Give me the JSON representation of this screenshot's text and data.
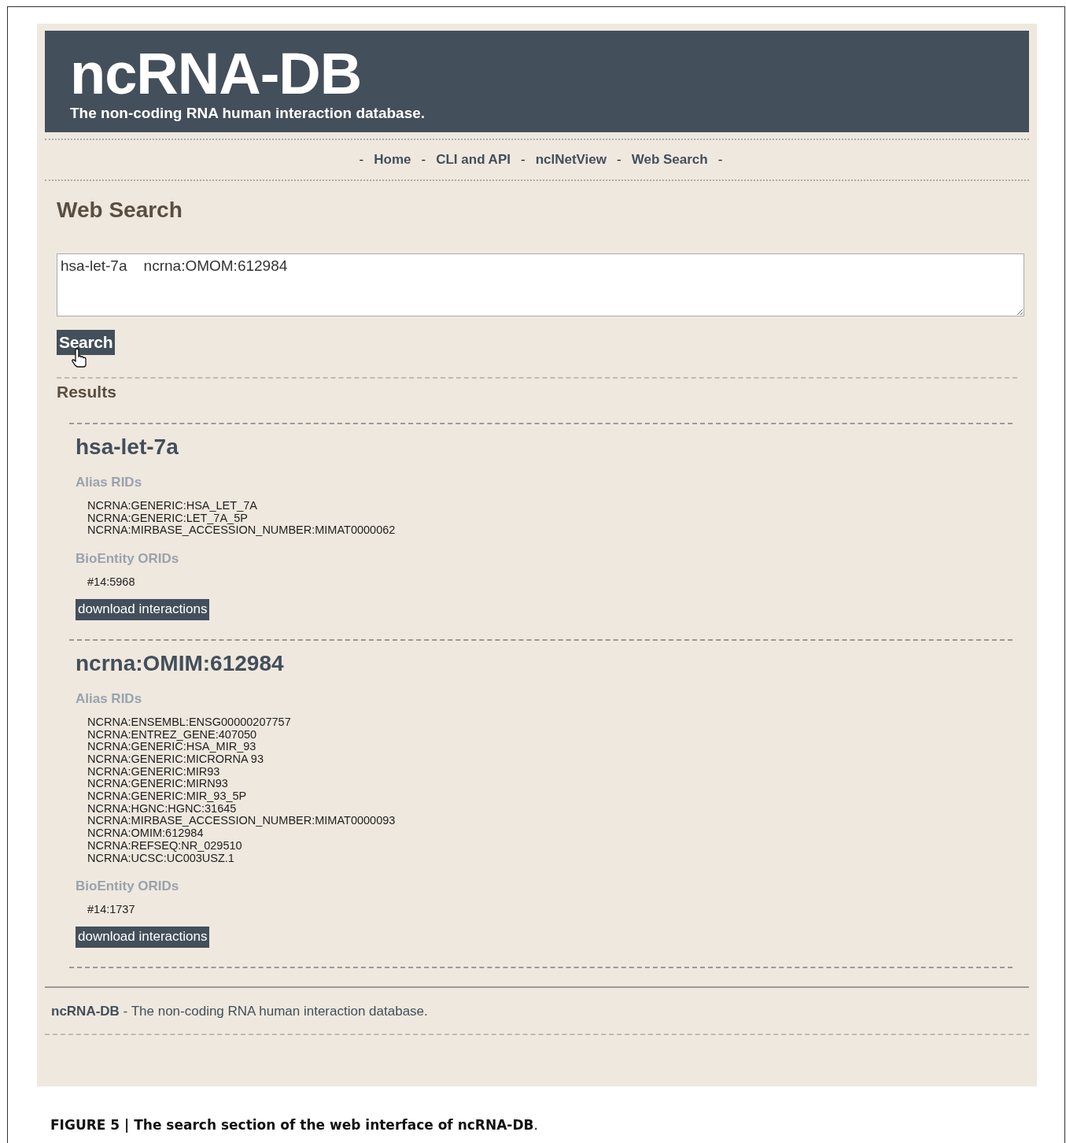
{
  "header": {
    "title": "ncRNA-DB",
    "subtitle": "The non-coding RNA human interaction database."
  },
  "nav": [
    {
      "kind": "separator",
      "text": "-"
    },
    {
      "kind": "link",
      "text": "Home"
    },
    {
      "kind": "separator",
      "text": "-"
    },
    {
      "kind": "link",
      "text": "CLI and API"
    },
    {
      "kind": "separator",
      "text": "-"
    },
    {
      "kind": "link",
      "text": "nclNetView"
    },
    {
      "kind": "separator",
      "text": "-"
    },
    {
      "kind": "link",
      "text": "Web Search"
    },
    {
      "kind": "separator",
      "text": "-"
    }
  ],
  "page_title": "Web Search",
  "search": {
    "value": "hsa-let-7a    ncrna:OMOM:612984",
    "button": "Search"
  },
  "results_heading": "Results",
  "results": [
    {
      "title": "hsa-let-7a",
      "alias_label": "Alias RIDs",
      "aliases": [
        "NCRNA:GENERIC:HSA_LET_7A",
        "NCRNA:GENERIC:LET_7A_5P",
        "NCRNA:MIRBASE_ACCESSION_NUMBER:MIMAT0000062"
      ],
      "orid_label": "BioEntity ORIDs",
      "orids": [
        "#14:5968"
      ],
      "button": "download interactions"
    },
    {
      "title": "ncrna:OMIM:612984",
      "alias_label": "Alias RIDs",
      "aliases": [
        "NCRNA:ENSEMBL:ENSG00000207757",
        "NCRNA:ENTREZ_GENE:407050",
        "NCRNA:GENERIC:HSA_MIR_93",
        "NCRNA:GENERIC:MICRORNA 93",
        "NCRNA:GENERIC:MIR93",
        "NCRNA:GENERIC:MIRN93",
        "NCRNA:GENERIC:MIR_93_5P",
        "NCRNA:HGNC:HGNC:31645",
        "NCRNA:MIRBASE_ACCESSION_NUMBER:MIMAT0000093",
        "NCRNA:OMIM:612984",
        "NCRNA:REFSEQ:NR_029510",
        "NCRNA:UCSC:UC003USZ.1"
      ],
      "orid_label": "BioEntity ORIDs",
      "orids": [
        "#14:1737"
      ],
      "button": "download interactions"
    }
  ],
  "footer": "**ncRNA-DB** - The non-coding RNA human interaction database.",
  "caption": "**FIGURE 5 | The search section of the web interface of ncRNA-DB**."
}
